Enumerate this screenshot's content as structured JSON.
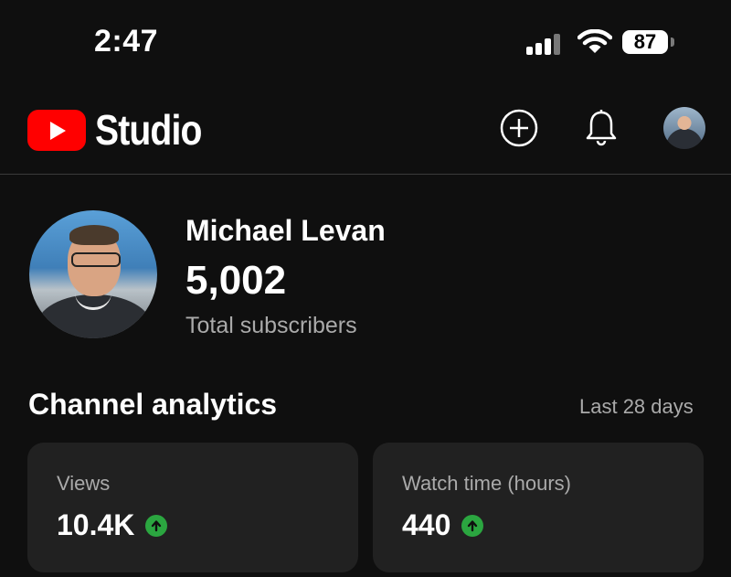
{
  "status_bar": {
    "time": "2:47",
    "battery": "87"
  },
  "app_bar": {
    "brand": "Studio"
  },
  "profile": {
    "channel_name": "Michael Levan",
    "subscriber_count": "5,002",
    "subscriber_label": "Total subscribers"
  },
  "analytics": {
    "title": "Channel analytics",
    "period": "Last 28 days",
    "cards": [
      {
        "label": "Views",
        "value": "10.4K",
        "trend": "up"
      },
      {
        "label": "Watch time (hours)",
        "value": "440",
        "trend": "up"
      }
    ]
  },
  "colors": {
    "background": "#0f0f0f",
    "card": "#212121",
    "brand_red": "#ff0000",
    "trend_up": "#2ba640"
  },
  "icons": [
    "cellular-signal-icon",
    "wifi-icon",
    "battery-icon",
    "youtube-logo-icon",
    "create-icon",
    "notifications-bell-icon",
    "arrow-up-icon"
  ]
}
